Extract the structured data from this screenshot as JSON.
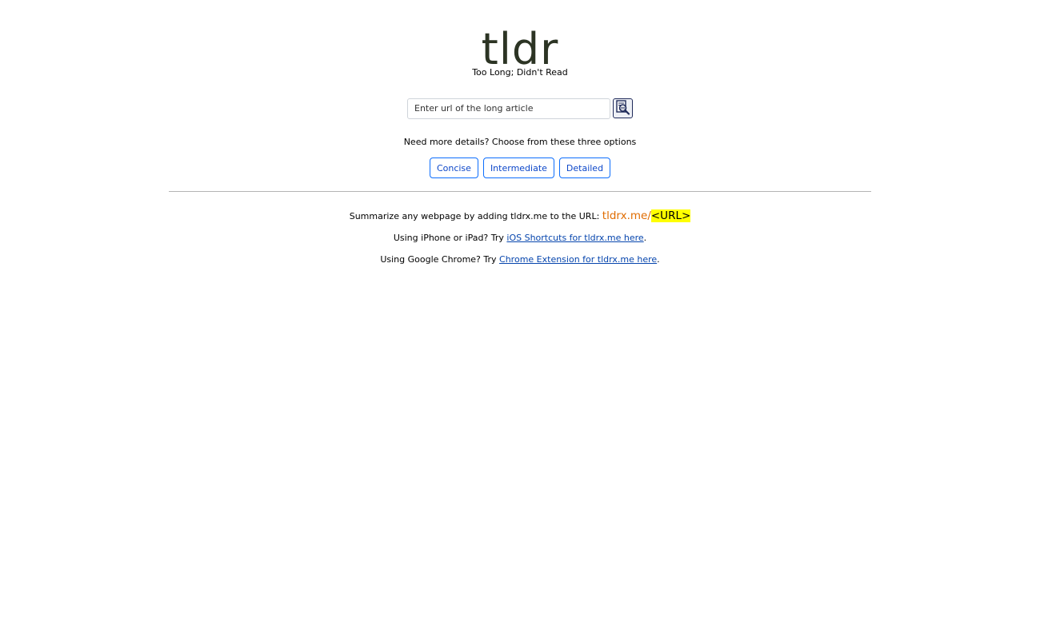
{
  "header": {
    "logo": "tldr",
    "tagline": "Too Long; Didn't Read"
  },
  "search": {
    "placeholder": "Enter url of the long article",
    "value": "",
    "button_icon": "document-search-icon"
  },
  "options": {
    "prompt": "Need more details? Choose from these three options",
    "buttons": [
      {
        "label": "Concise"
      },
      {
        "label": "Intermediate"
      },
      {
        "label": "Detailed"
      }
    ]
  },
  "info": {
    "line1_text": "Summarize any webpage by adding tldrx.me to the URL: ",
    "line1_url_prefix": "tldrx.me/",
    "line1_url_placeholder": "<URL>",
    "line2_text": "Using iPhone or iPad? Try ",
    "line2_link": "iOS Shortcuts for tldrx.me here",
    "line2_suffix": ".",
    "line3_text": "Using Google Chrome? Try ",
    "line3_link": "Chrome Extension for tldrx.me here",
    "line3_suffix": "."
  },
  "colors": {
    "logo": "#2c3424",
    "accent_button": "#0d6efd",
    "url_prefix": "#e06c00",
    "highlight": "#ffff00",
    "link": "#0645ad"
  }
}
